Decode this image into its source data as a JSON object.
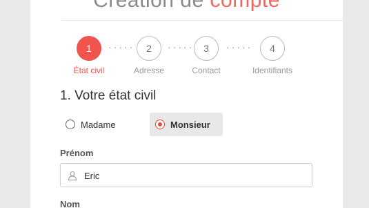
{
  "header": {
    "title_prefix": "Création de ",
    "title_accent": "compte",
    "accent_color": "#f0544e"
  },
  "steps": [
    {
      "number": "1",
      "label": "État civil",
      "active": true
    },
    {
      "number": "2",
      "label": "Adresse",
      "active": false
    },
    {
      "number": "3",
      "label": "Contact",
      "active": false
    },
    {
      "number": "4",
      "label": "Identifiants",
      "active": false
    }
  ],
  "step_separator": "·····",
  "section": {
    "title": "1. Votre état civil"
  },
  "civility": {
    "options": [
      {
        "label": "Madame",
        "selected": false
      },
      {
        "label": "Monsieur",
        "selected": true
      }
    ]
  },
  "fields": {
    "prenom": {
      "label": "Prénom",
      "value": "Eric",
      "icon": "user-icon"
    },
    "nom": {
      "label": "Nom"
    }
  }
}
